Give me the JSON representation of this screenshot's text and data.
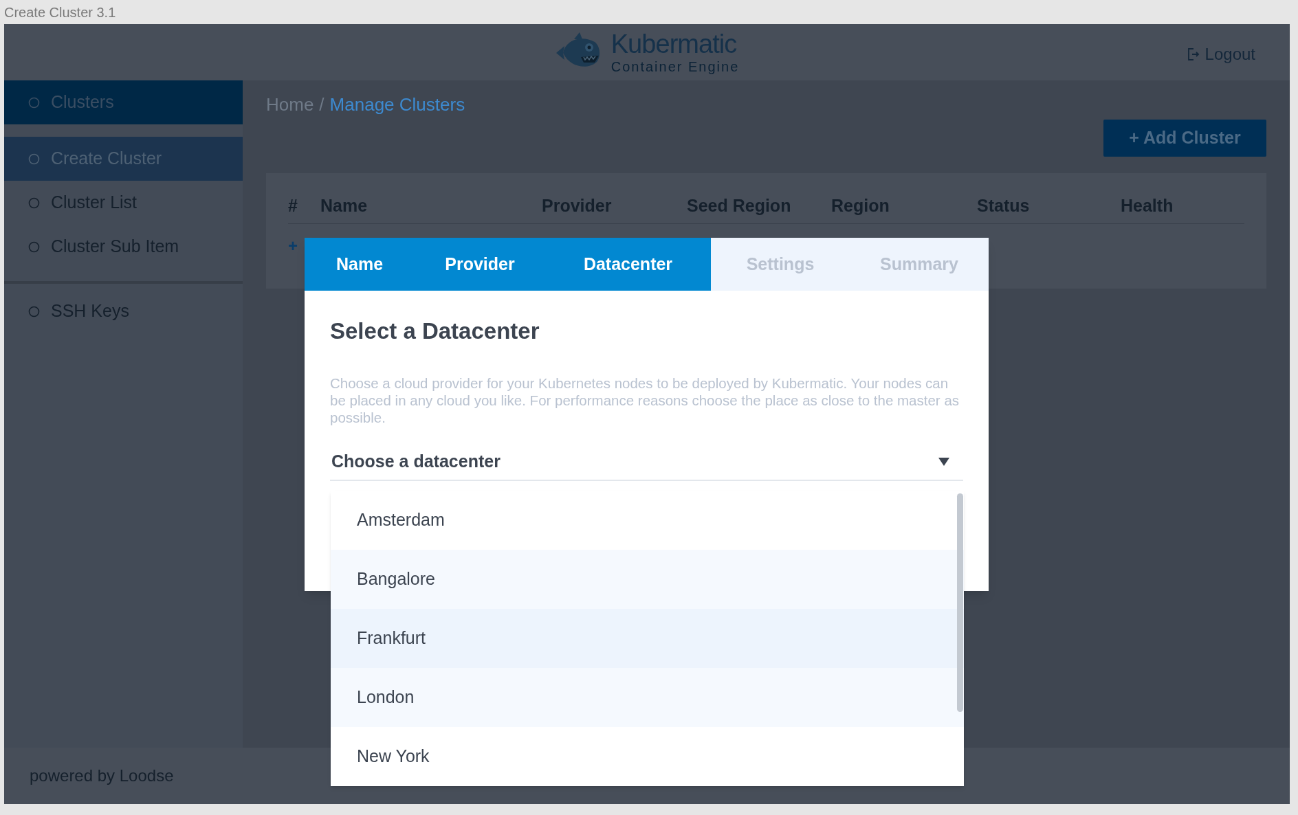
{
  "window": {
    "title": "Create Cluster 3.1"
  },
  "header": {
    "logo_title": "Kubermatic",
    "logo_subtitle": "Container Engine",
    "logout": "Logout"
  },
  "sidebar": {
    "items": [
      {
        "label": "Clusters",
        "selected": true,
        "children": [
          {
            "label": "Create Cluster",
            "selected": true
          },
          {
            "label": "Cluster List",
            "selected": false
          },
          {
            "label": "Cluster Sub Item",
            "selected": false
          }
        ]
      },
      {
        "label": "SSH Keys",
        "selected": false
      }
    ],
    "footer": "powered by Loodse"
  },
  "breadcrumb": {
    "separator": "/",
    "items": [
      {
        "label": "Home",
        "current": false
      },
      {
        "label": "Manage Clusters",
        "current": true
      }
    ]
  },
  "add_button": "+ Add Cluster",
  "table": {
    "columns": [
      "#",
      "Name",
      "Provider",
      "Seed Region",
      "Region",
      "Status",
      "Health"
    ],
    "add_row": "+"
  },
  "dialog": {
    "tabs": [
      {
        "label": "Name",
        "active": true
      },
      {
        "label": "Provider",
        "active": true
      },
      {
        "label": "Datacenter",
        "active": true
      },
      {
        "label": "Settings",
        "active": false
      },
      {
        "label": "Summary",
        "active": false
      }
    ],
    "title": "Select a Datacenter",
    "description": "Choose a cloud provider for your Kubernetes nodes to be deployed by Kubermatic. Your nodes can be placed in any cloud you like. For performance reasons choose the place as close to the master as possible.",
    "select": {
      "placeholder": "Choose a datacenter",
      "expanded": true,
      "options": [
        {
          "label": "Amsterdam",
          "highlighted": false
        },
        {
          "label": "Bangalore",
          "highlighted": false
        },
        {
          "label": "Frankfurt",
          "highlighted": true
        },
        {
          "label": "London",
          "highlighted": false
        },
        {
          "label": "New York",
          "highlighted": false
        }
      ]
    }
  }
}
